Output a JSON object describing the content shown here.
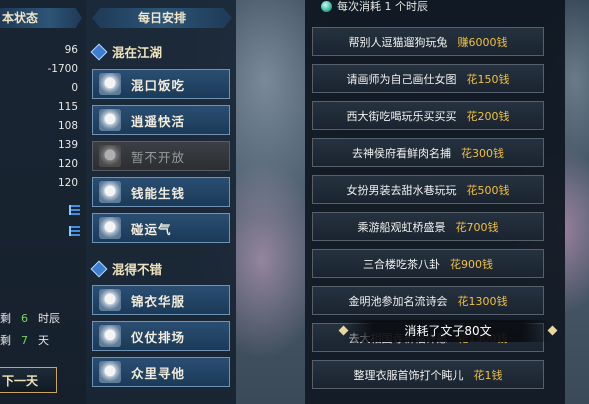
{
  "stats": {
    "title": "本状态",
    "values": [
      "96",
      "-1700",
      "0",
      "115",
      "108",
      "139",
      "120",
      "120"
    ],
    "remaining": [
      {
        "prefix": "剩",
        "value": "6",
        "unit": "时辰"
      },
      {
        "prefix": "剩",
        "value": "7",
        "unit": "天"
      }
    ],
    "next_day_label": "下一天"
  },
  "schedule": {
    "title": "每日安排",
    "section1": "混在江湖",
    "section2": "混得不错",
    "activities1": [
      {
        "label": "混口饭吃",
        "enabled": true
      },
      {
        "label": "逍遥快活",
        "enabled": true
      },
      {
        "label": "暂不开放",
        "enabled": false
      },
      {
        "label": "钱能生钱",
        "enabled": true
      },
      {
        "label": "碰运气",
        "enabled": true
      }
    ],
    "activities2": [
      {
        "label": "锦衣华服",
        "enabled": true
      },
      {
        "label": "仪仗排场",
        "enabled": true
      },
      {
        "label": "众里寻他",
        "enabled": true
      }
    ]
  },
  "options": {
    "cost_note": "每次消耗 1 个时辰",
    "items": [
      {
        "text": "帮别人逗猫遛狗玩兔",
        "cost": "赚6000钱"
      },
      {
        "text": "请画师为自己画仕女图",
        "cost": "花150钱"
      },
      {
        "text": "西大街吃喝玩乐买买买",
        "cost": "花200钱"
      },
      {
        "text": "去神侯府看鲜肉名捕",
        "cost": "花300钱"
      },
      {
        "text": "女扮男装去甜水巷玩玩",
        "cost": "花500钱"
      },
      {
        "text": "乘游船观虹桥盛景",
        "cost": "花700钱"
      },
      {
        "text": "三合楼吃茶八卦",
        "cost": "花900钱"
      },
      {
        "text": "金明池参加名流诗会",
        "cost": "花1300钱"
      },
      {
        "text": "去大相国寺祈福许愿",
        "cost": "花1500钱"
      },
      {
        "text": "整理衣服首饰打个盹儿",
        "cost": "花1钱"
      }
    ]
  },
  "toast": "消耗了文子80文",
  "colors": {
    "cost_gold": "#f0c040",
    "remain_green": "#7cd06a",
    "panel_blue": "#1b3a58"
  }
}
